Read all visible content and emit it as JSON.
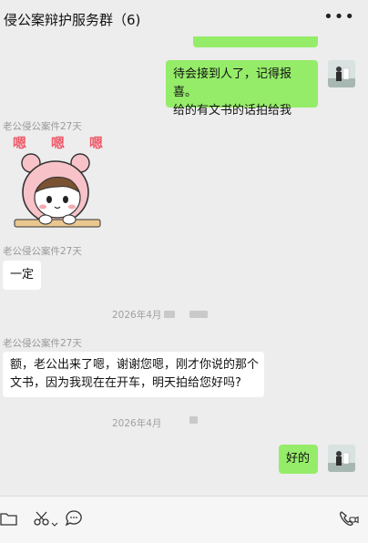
{
  "header": {
    "title": "侵公案辩护服务群（6)",
    "more_glyph": "•••"
  },
  "messages": {
    "m1": {
      "line1": "待会接到人了，记得报喜。",
      "line2": "给的有文书的话拍给我"
    },
    "sender1": "老公侵公案件27天",
    "sticker_text": "嗯 嗯 嗯",
    "sender2": "老公侵公案件27天",
    "m2": "一定",
    "time1": "2026年4月",
    "sender3": "老公侵公案件27天",
    "m3": {
      "line1": "额，老公出来了嗯，谢谢您嗯，刚才你说的那个",
      "line2": "文书，因为我现在在开车，明天拍给您好吗?"
    },
    "time2": "2026年4月",
    "m4": "好的"
  },
  "colors": {
    "self_bubble": "#95ec69",
    "other_bubble": "#ffffff",
    "background": "#ededed"
  },
  "toolbar": {
    "icons": [
      "folder-icon",
      "scissors-icon",
      "chat-icon",
      "video-call-icon"
    ]
  }
}
